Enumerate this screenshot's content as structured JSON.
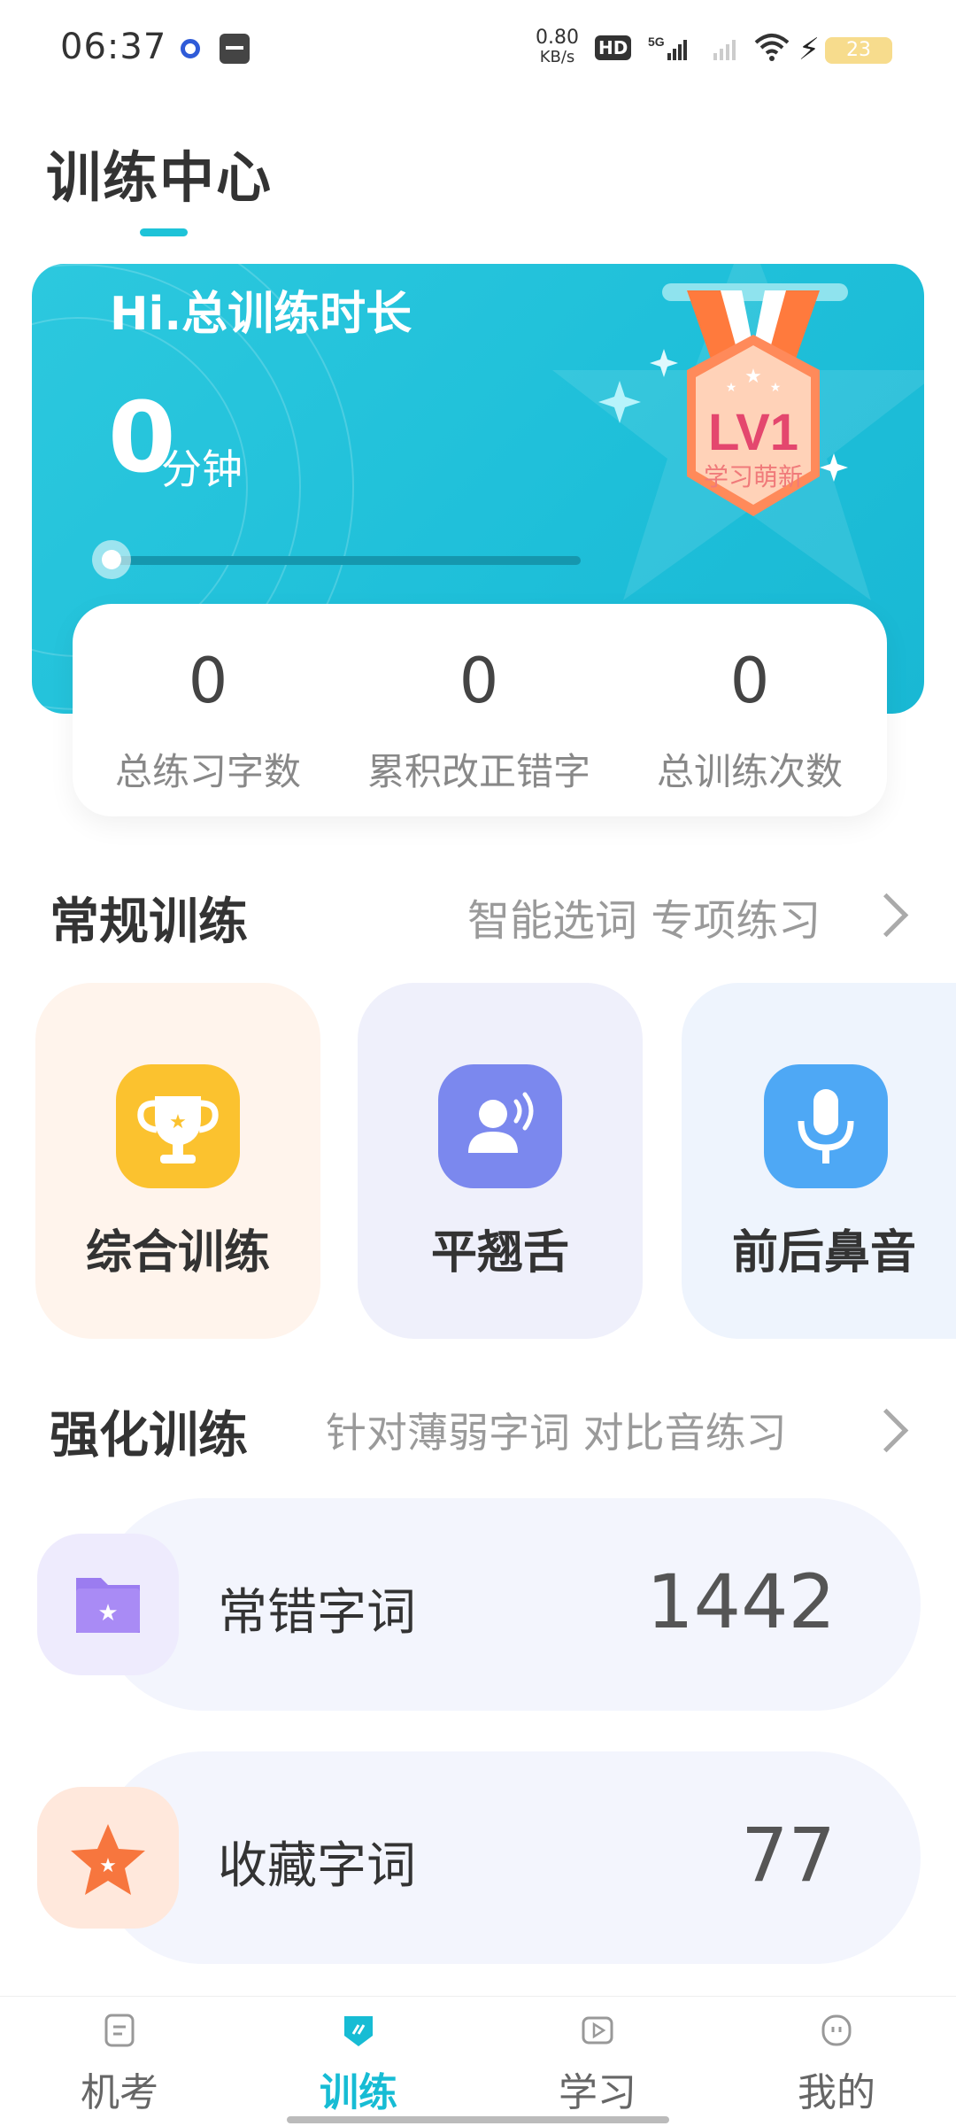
{
  "status_bar": {
    "time": "06:37",
    "net_speed_value": "0.80",
    "net_speed_unit": "KB/s",
    "hd_label": "HD",
    "network": "5G",
    "battery": "23"
  },
  "header": {
    "title": "训练中心"
  },
  "hero": {
    "greeting": "Hi.总训练时长",
    "duration_value": "0",
    "duration_unit": "分钟",
    "progress": 0,
    "badge_level": "LV1",
    "badge_title": "学习萌新"
  },
  "stats": [
    {
      "value": "0",
      "label": "总练习字数"
    },
    {
      "value": "0",
      "label": "累积改正错字"
    },
    {
      "value": "0",
      "label": "总训练次数"
    }
  ],
  "regular_training": {
    "title": "常规训练",
    "subtitle": "智能选词 专项练习",
    "items": [
      {
        "label": "综合训练",
        "icon": "trophy-icon"
      },
      {
        "label": "平翘舌",
        "icon": "speaker-person-icon"
      },
      {
        "label": "前后鼻音",
        "icon": "microphone-icon"
      }
    ]
  },
  "intensive_training": {
    "title": "强化训练",
    "subtitle": "针对薄弱字词 对比音练习",
    "items": [
      {
        "label": "常错字词",
        "count": "1442",
        "icon": "folder-star-icon"
      },
      {
        "label": "收藏字词",
        "count": "77",
        "icon": "star-icon"
      }
    ]
  },
  "tabs": [
    {
      "label": "机考",
      "icon": "exam-icon",
      "active": false
    },
    {
      "label": "训练",
      "icon": "training-icon",
      "active": true
    },
    {
      "label": "学习",
      "icon": "play-icon",
      "active": false
    },
    {
      "label": "我的",
      "icon": "profile-icon",
      "active": false
    }
  ],
  "colors": {
    "accent": "#1ec3d8",
    "trophy_tile_bg": "#fff4ec",
    "trophy_icon_bg": "#fbc22f",
    "voice_tile_bg": "#eff0fb",
    "voice_icon_bg": "#7b88ee",
    "mic_tile_bg": "#eef4fd",
    "mic_icon_bg": "#4ea8f5"
  }
}
